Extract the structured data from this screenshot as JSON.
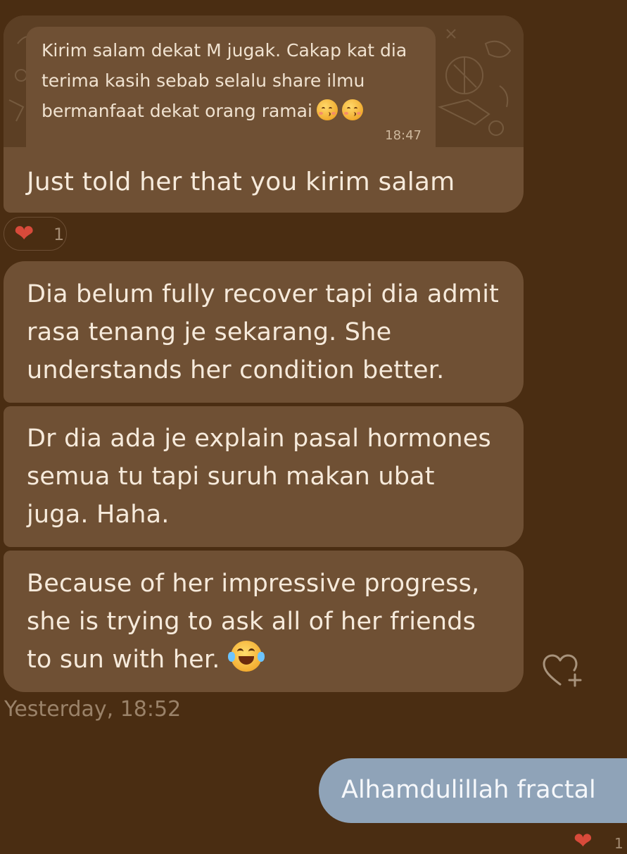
{
  "chat": {
    "messages": [
      {
        "quote": {
          "text": "Kirim salam dekat M jugak. Cakap kat dia terima kasih sebab selalu share ilmu bermanfaat dekat orang ramai",
          "emojis": [
            "kissing-face-icon",
            "kissing-face-icon"
          ],
          "time": "18:47"
        },
        "text": "Just told her that you kirim salam",
        "reaction": {
          "icon": "heart-icon",
          "count": "1"
        }
      },
      {
        "text": "Dia belum fully recover tapi dia admit rasa tenang je sekarang. She understands her condition better."
      },
      {
        "text": "Dr dia ada je explain pasal hormones semua tu tapi suruh makan ubat juga. Haha."
      },
      {
        "text": "Because of her impressive progress, she is trying to ask all of her friends to sun with her.",
        "emoji": "face-with-tears-of-joy-icon"
      }
    ],
    "timestamp": "Yesterday, 18:52",
    "outgoing": {
      "text": "Alhamdulillah fractal",
      "reaction": {
        "icon": "heart-icon",
        "count": "1"
      }
    }
  },
  "colors": {
    "background": "#4a2d12",
    "incoming_bubble": "#6f5034",
    "outgoing_bubble": "#8fa3b8",
    "reaction_heart": "#d84a3a"
  }
}
